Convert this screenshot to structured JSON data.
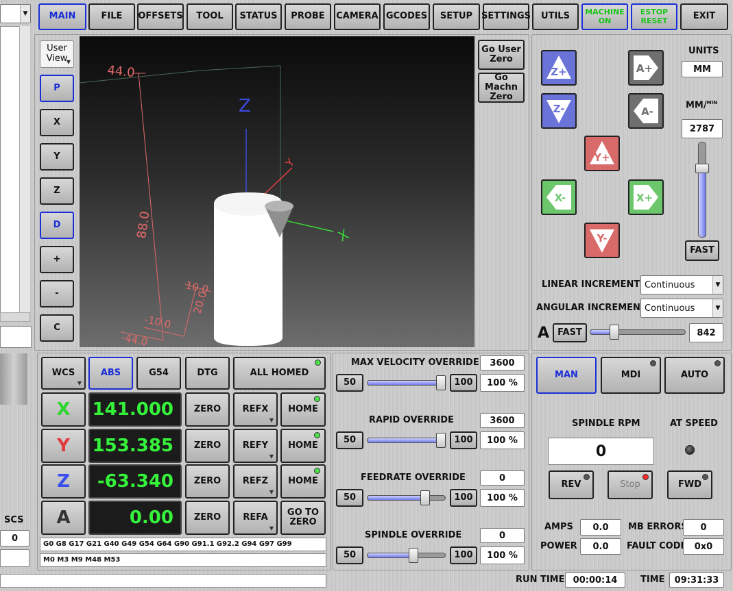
{
  "tabs": [
    {
      "label": "MAIN"
    },
    {
      "label": "FILE"
    },
    {
      "label": "OFFSETS"
    },
    {
      "label": "TOOL"
    },
    {
      "label": "STATUS"
    },
    {
      "label": "PROBE"
    },
    {
      "label": "CAMERA"
    },
    {
      "label": "GCODES"
    },
    {
      "label": "SETUP"
    },
    {
      "label": "SETTINGS"
    },
    {
      "label": "UTILS"
    },
    {
      "label": "MACHINE ON"
    },
    {
      "label": "ESTOP RESET"
    },
    {
      "label": "EXIT"
    }
  ],
  "view": {
    "user_view": "User View",
    "side_buttons": [
      "P",
      "X",
      "Y",
      "Z",
      "D",
      "+",
      "-",
      "C"
    ],
    "go_user_zero": "Go User Zero",
    "go_machine_zero": "Go Machn Zero",
    "dims": {
      "top": "44.0",
      "side": "88.0",
      "a": "10.0",
      "b": "20.0",
      "c": "-10.0",
      "d": "-44.0"
    },
    "axis_z": "Z",
    "axis_x": "X",
    "axis_y": "Y"
  },
  "jog": {
    "units_label": "UNITS",
    "units_value": "MM",
    "rate_label": "MM/",
    "rate_sup": "MIN",
    "rate_value": "2787",
    "fast": "FAST",
    "keys": {
      "zplus": "Z+",
      "zminus": "Z-",
      "aplus": "A+",
      "aminus": "A-",
      "yplus": "Y+",
      "yminus": "Y-",
      "xminus": "X-",
      "xplus": "X+"
    },
    "linear_increment_label": "LINEAR INCREMENT",
    "linear_increment_value": "Continuous",
    "angular_increment_label": "ANGULAR INCREMENT",
    "angular_increment_value": "Continuous",
    "a_label": "A",
    "a_fast": "FAST",
    "a_rate": "842",
    "rate_slider_level": 0.72,
    "a_slider_level": 0.26
  },
  "dro": {
    "wcs": "WCS",
    "abs": "ABS",
    "g54": "G54",
    "dtg": "DTG",
    "all_homed": "ALL HOMED",
    "axes": [
      {
        "axis": "X",
        "value": "141.000",
        "zero": "ZERO",
        "ref": "REFX",
        "home": "HOME",
        "color": "#2fd52f"
      },
      {
        "axis": "Y",
        "value": "153.385",
        "zero": "ZERO",
        "ref": "REFY",
        "home": "HOME",
        "color": "#e23b3b"
      },
      {
        "axis": "Z",
        "value": "-63.340",
        "zero": "ZERO",
        "ref": "REFZ",
        "home": "HOME",
        "color": "#3a4ff0"
      },
      {
        "axis": "A",
        "value": "0.00",
        "zero": "ZERO",
        "ref": "REFA",
        "home": "GO TO ZERO",
        "color": "#333333"
      }
    ],
    "gcodes_line": "G0 G8 G17 G21 G40 G49 G54 G64 G90 G91.1 G92.2 G94 G97 G99",
    "mcodes_line": "M0 M3 M9 M48 M53"
  },
  "overrides": [
    {
      "title": "MAX VELOCITY OVERRIDE",
      "value": "3600",
      "min": "50",
      "max": "100",
      "percent": "100 %",
      "level": 1.0
    },
    {
      "title": "RAPID OVERRIDE",
      "value": "3600",
      "min": "50",
      "max": "100",
      "percent": "100 %",
      "level": 1.0
    },
    {
      "title": "FEEDRATE OVERRIDE",
      "value": "0",
      "min": "50",
      "max": "100",
      "percent": "100 %",
      "level": 0.75
    },
    {
      "title": "SPINDLE OVERRIDE",
      "value": "0",
      "min": "50",
      "max": "100",
      "percent": "100 %",
      "level": 0.6
    }
  ],
  "modes": {
    "man": "MAN",
    "mdi": "MDI",
    "auto": "AUTO"
  },
  "spindle": {
    "rpm_label": "SPINDLE RPM",
    "at_speed_label": "AT SPEED",
    "rpm_value": "0",
    "rev": "REV",
    "stop": "Stop",
    "fwd": "FWD"
  },
  "status": {
    "amps_label": "AMPS",
    "amps": "0.0",
    "mb_errors_label": "MB ERRORS",
    "mb_errors": "0",
    "power_label": "POWER",
    "power": "0.0",
    "fault_code_label": "FAULT CODE",
    "fault_code": "0x0"
  },
  "footer": {
    "run_time_label": "RUN TIME",
    "run_time": "00:00:14",
    "time_label": "TIME",
    "time": "09:31:33"
  },
  "left": {
    "scs_label": "SCS",
    "scs_value": "0"
  },
  "colors": {
    "active_border": "#1b2fd6",
    "dro_text": "#35f23a",
    "led_green": "#4be04b",
    "led_red": "#ff2a2a",
    "jog_blue": "#6a73d8",
    "jog_red": "#d96a6a",
    "jog_green": "#6cc76c"
  }
}
